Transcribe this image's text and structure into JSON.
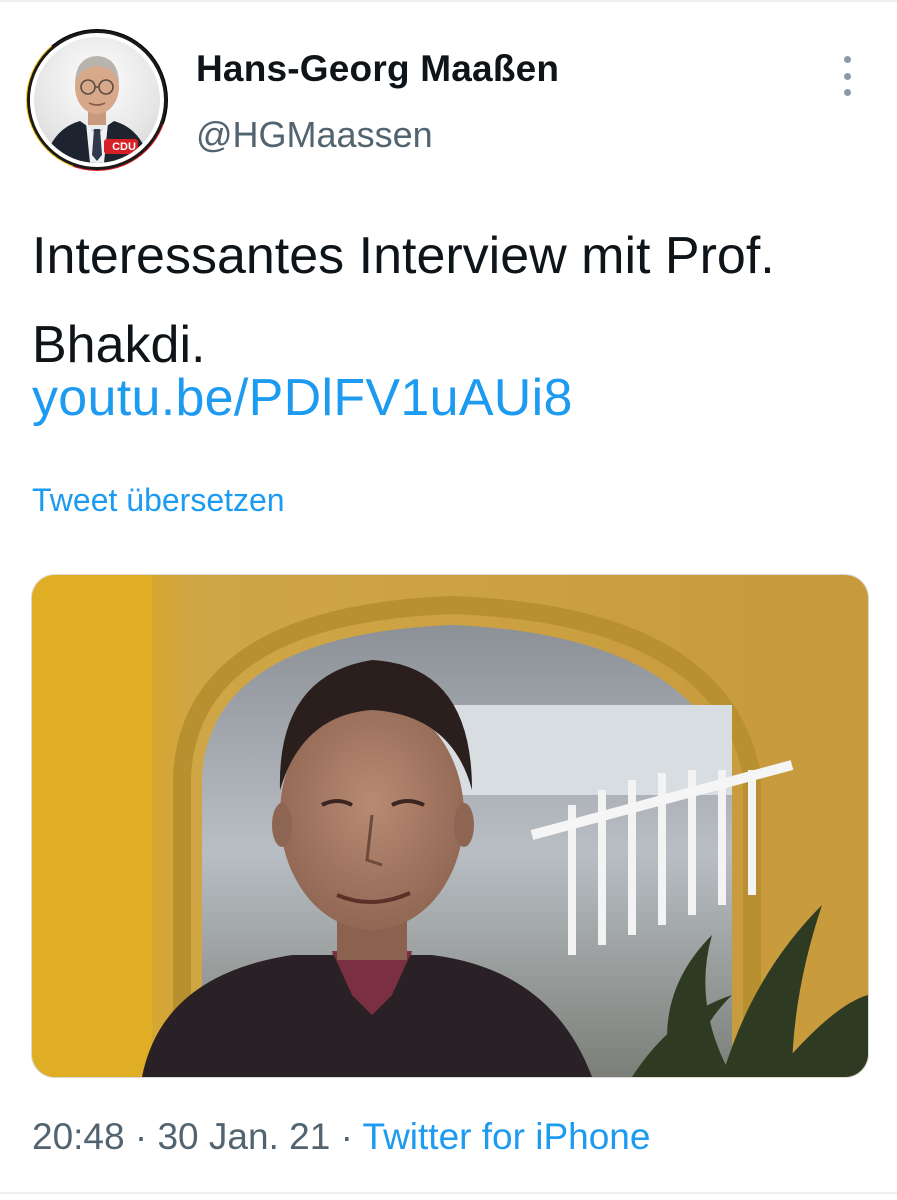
{
  "author": {
    "display_name": "Hans-Georg Maaßen",
    "handle": "@HGMaassen",
    "avatar_badge": "CDU",
    "avatar_icon": "profile-photo"
  },
  "tweet": {
    "text": "Interessantes Interview mit Prof. Bhakdi.",
    "link": "youtu.be/PDlFV1uAUi8",
    "translate_label": "Tweet übersetzen"
  },
  "meta": {
    "time": "20:48",
    "separator": "·",
    "date": "30 Jan. 21",
    "source": "Twitter for iPhone"
  },
  "icons": {
    "more": "more-vertical-icon"
  },
  "colors": {
    "link": "#1d9bf0",
    "secondary_text": "#536471",
    "primary_text": "#0f1419",
    "background": "#ffffff"
  }
}
